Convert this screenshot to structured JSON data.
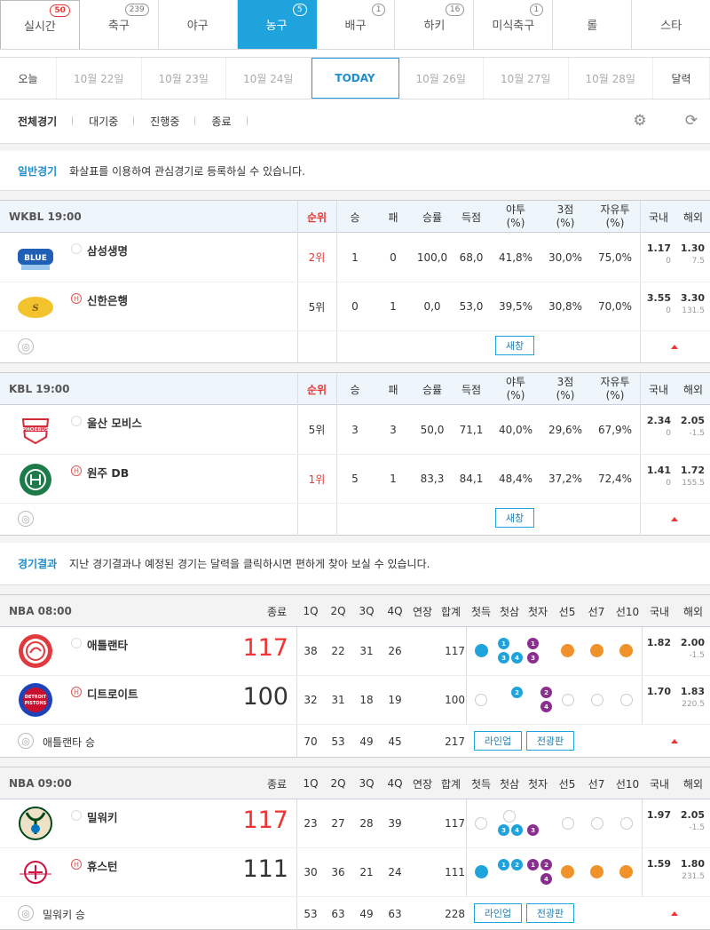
{
  "sports_tabs": [
    {
      "label": "실시간",
      "count": "50"
    },
    {
      "label": "축구",
      "count": "239"
    },
    {
      "label": "야구",
      "count": ""
    },
    {
      "label": "농구",
      "count": "5"
    },
    {
      "label": "배구",
      "count": "1"
    },
    {
      "label": "하키",
      "count": "16"
    },
    {
      "label": "미식축구",
      "count": "1"
    },
    {
      "label": "롤",
      "count": ""
    },
    {
      "label": "스타",
      "count": ""
    }
  ],
  "dates": {
    "today_btn": "오늘",
    "d1": "10월 22일",
    "d2": "10월 23일",
    "d3": "10월 24일",
    "today": "TODAY",
    "d5": "10월 26일",
    "d6": "10월 27일",
    "d7": "10월 28일",
    "calendar": "달력"
  },
  "filters": {
    "all": "전체경기",
    "waiting": "대기중",
    "live": "진행중",
    "ended": "종료"
  },
  "notice1": {
    "label": "일반경기",
    "text": "화살표를 이용하여 관심경기로 등록하실 수 있습니다."
  },
  "notice2": {
    "label": "경기결과",
    "text": "지난 경기결과나 예정된 경기는 달력을 클릭하시면 편하게 찾아 보실 수 있습니다."
  },
  "stat_headers": {
    "rank": "순위",
    "win": "승",
    "loss": "패",
    "rate": "승률",
    "pts": "득점",
    "fg": "야투\n(%)",
    "three": "3점\n(%)",
    "ft": "자유투\n(%)",
    "dom": "국내",
    "intl": "해외"
  },
  "result_headers": {
    "final": "종료",
    "q1": "1Q",
    "q2": "2Q",
    "q3": "3Q",
    "q4": "4Q",
    "ot": "연장",
    "total": "합계",
    "first_point": "첫득",
    "first_3": "첫삼",
    "first_ft": "첫자",
    "to5": "선5",
    "to7": "선7",
    "to10": "선10",
    "dom": "국내",
    "intl": "해외"
  },
  "home_marker": "H",
  "buttons": {
    "newwin": "새창",
    "lineup": "라인업",
    "board": "전광판"
  },
  "game1": {
    "title": "WKBL  19:00",
    "team1": {
      "name": "삼성생명",
      "rank": "2위",
      "w": "1",
      "l": "0",
      "rate": "100,0",
      "pts": "68,0",
      "fg": "41,8%",
      "three": "30,0%",
      "ft": "75,0%",
      "dom": "1.17",
      "dom2": "0",
      "intl": "1.30",
      "intl2": "7.5"
    },
    "team2": {
      "name": "신한은행",
      "rank": "5위",
      "w": "0",
      "l": "1",
      "rate": "0,0",
      "pts": "53,0",
      "fg": "39,5%",
      "three": "30,8%",
      "ft": "70,0%",
      "dom": "3.55",
      "dom2": "0",
      "intl": "3.30",
      "intl2": "131.5"
    }
  },
  "game2": {
    "title": "KBL  19:00",
    "team1": {
      "name": "울산 모비스",
      "rank": "5위",
      "w": "3",
      "l": "3",
      "rate": "50,0",
      "pts": "71,1",
      "fg": "40,0%",
      "three": "29,6%",
      "ft": "67,9%",
      "dom": "2.34",
      "dom2": "0",
      "intl": "2.05",
      "intl2": "-1.5"
    },
    "team2": {
      "name": "원주 DB",
      "rank": "1위",
      "w": "5",
      "l": "1",
      "rate": "83,3",
      "pts": "84,1",
      "fg": "48,4%",
      "three": "37,2%",
      "ft": "72,4%",
      "dom": "1.41",
      "dom2": "0",
      "intl": "1.72",
      "intl2": "155.5"
    }
  },
  "game3": {
    "title": "NBA  08:00",
    "team1": {
      "name": "애틀랜타",
      "score": "117",
      "q": [
        "38",
        "22",
        "31",
        "26"
      ],
      "ot": "",
      "total": "117",
      "dom": "1.82",
      "intl": "2.00",
      "intl2": "-1.5"
    },
    "team2": {
      "name": "디트로이트",
      "score": "100",
      "q": [
        "32",
        "31",
        "18",
        "19"
      ],
      "ot": "",
      "total": "100",
      "dom": "1.70",
      "intl": "1.83",
      "intl2": "220.5"
    },
    "footer": {
      "winner": "애틀랜타 승",
      "q": [
        "70",
        "53",
        "49",
        "45"
      ],
      "total": "217"
    }
  },
  "game4": {
    "title": "NBA  09:00",
    "team1": {
      "name": "밀워키",
      "score": "117",
      "q": [
        "23",
        "27",
        "28",
        "39"
      ],
      "ot": "",
      "total": "117",
      "dom": "1.97",
      "intl": "2.05",
      "intl2": "-1.5"
    },
    "team2": {
      "name": "휴스턴",
      "score": "111",
      "q": [
        "30",
        "36",
        "21",
        "24"
      ],
      "ot": "",
      "total": "111",
      "dom": "1.59",
      "intl": "1.80",
      "intl2": "231.5"
    },
    "footer": {
      "winner": "밀워키 승",
      "q": [
        "53",
        "63",
        "49",
        "63"
      ],
      "total": "228"
    }
  },
  "colors": {
    "accent": "#1fa3dc",
    "red": "#e33",
    "orange": "#f0922a",
    "purple": "#8a2f8f",
    "blue_dot": "#1fa3dc"
  }
}
